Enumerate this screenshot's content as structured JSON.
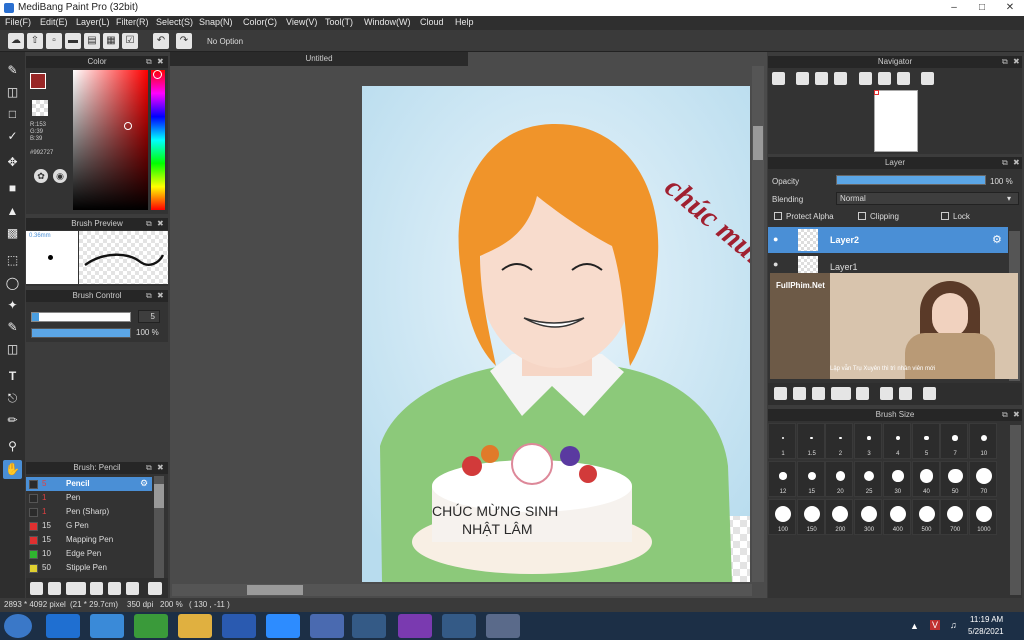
{
  "window": {
    "title": "MediBang Paint Pro (32bit)"
  },
  "menu": [
    "File(F)",
    "Edit(E)",
    "Layer(L)",
    "Filter(R)",
    "Select(S)",
    "Snap(N)",
    "Color(C)",
    "View(V)",
    "Tool(T)",
    "Window(W)",
    "Cloud",
    "Help"
  ],
  "toolbar": {
    "option_label": "No Option"
  },
  "color_panel": {
    "title": "Color",
    "rgb_r": "R:153",
    "rgb_g": "G:39",
    "rgb_b": "B:39",
    "hex": "#992727",
    "foreground": "#992727"
  },
  "brush_preview": {
    "title": "Brush Preview",
    "size": "0.36mm"
  },
  "brush_control": {
    "title": "Brush Control",
    "size_value": "5",
    "opacity_value": "100 %"
  },
  "brush_panel": {
    "title": "Brush: Pencil",
    "items": [
      {
        "size": "5",
        "name": "Pencil",
        "color": "#2b2b2b"
      },
      {
        "size": "1",
        "name": "Pen",
        "color": "#2b2b2b"
      },
      {
        "size": "1",
        "name": "Pen (Sharp)",
        "color": "#2b2b2b"
      },
      {
        "size": "15",
        "name": "G Pen",
        "color": "#e03030"
      },
      {
        "size": "15",
        "name": "Mapping Pen",
        "color": "#e03030"
      },
      {
        "size": "10",
        "name": "Edge Pen",
        "color": "#2fb52f"
      },
      {
        "size": "50",
        "name": "Stipple Pen",
        "color": "#e0d030"
      }
    ]
  },
  "document": {
    "tab_title": "Untitled"
  },
  "canvas_text": {
    "greeting": "chúc mừng",
    "cake_line1": "CHÚC MỪNG SINH",
    "cake_line2": "NHẬT LÂM"
  },
  "navigator": {
    "title": "Navigator"
  },
  "layer_panel": {
    "title": "Layer",
    "opacity_label": "Opacity",
    "opacity_value": "100 %",
    "opacity_fraction": 1.0,
    "blending_label": "Blending",
    "blending_value": "Normal",
    "protect_alpha": "Protect Alpha",
    "clipping": "Clipping",
    "lock": "Lock",
    "layers": [
      {
        "name": "Layer2",
        "selected": true
      },
      {
        "name": "Layer1",
        "selected": false
      }
    ]
  },
  "video_overlay": {
    "watermark": "FullPhim.Net",
    "subtitle": "Lập vẫn Trụ Xuyên thì trì nhân viên mới"
  },
  "brush_size": {
    "title": "Brush Size",
    "row1": [
      "1",
      "1.5",
      "2",
      "3",
      "4",
      "5",
      "7",
      "10"
    ],
    "row2": [
      "12",
      "15",
      "20",
      "25",
      "30",
      "40",
      "50",
      "70"
    ],
    "row3": [
      "100",
      "150",
      "200",
      "300",
      "400",
      "500",
      "700",
      "1000"
    ]
  },
  "status": {
    "dimensions": "2893 * 4092 pixel",
    "size_cm": "(21 * 29.7cm)",
    "dpi": "350 dpi",
    "zoom": "200 %",
    "coords": "( 130 , -11 )"
  },
  "taskbar": {
    "time": "11:19 AM",
    "date": "5/28/2021"
  }
}
